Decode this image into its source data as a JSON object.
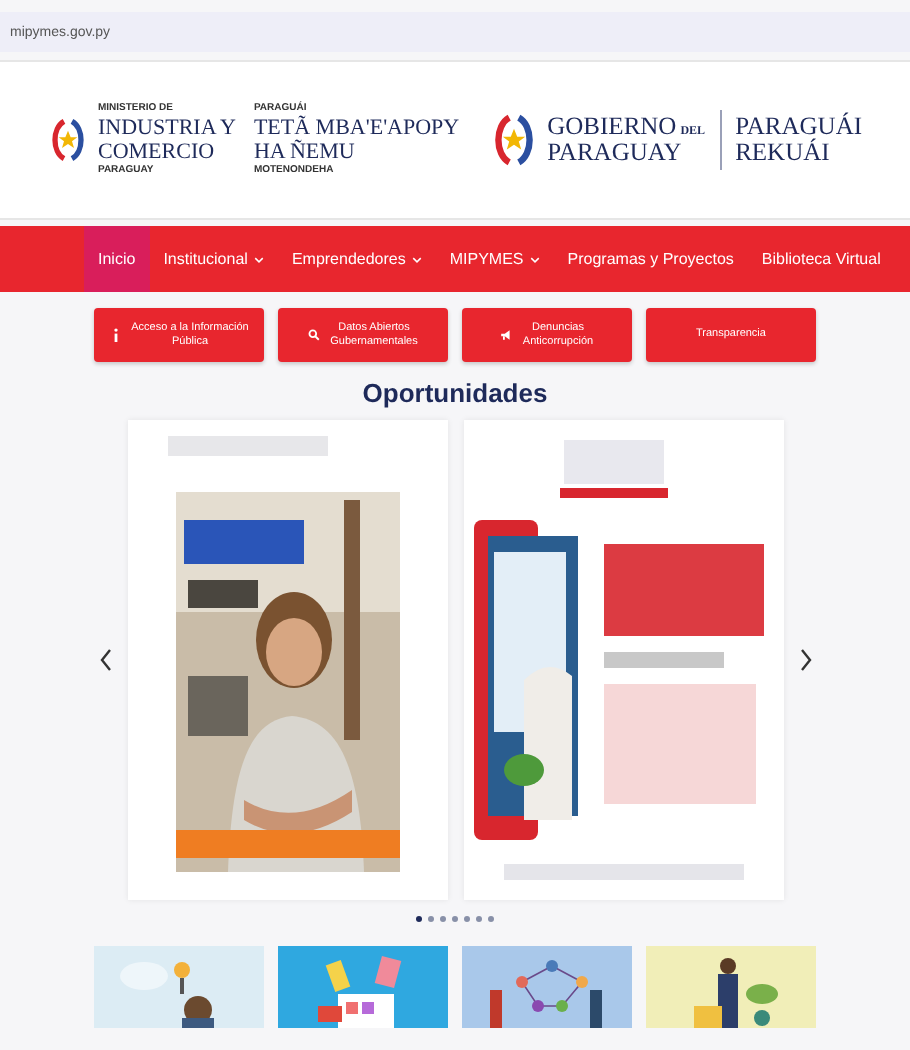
{
  "url": "mipymes.gov.py",
  "header": {
    "ministry": {
      "top": "MINISTERIO DE",
      "name_lines": [
        "INDUSTRIA Y",
        "COMERCIO"
      ],
      "bottom": "PARAGUAY"
    },
    "ministry_guarani": {
      "top": "PARAGUÁI",
      "name_lines": [
        "TETÃ MBA'E'APOPY",
        "HA ÑEMU"
      ],
      "bottom": "MOTENONDEHA"
    },
    "government": {
      "name": "GOBIERNO",
      "small": "DEL",
      "country": "PARAGUAY",
      "slogan_lines": [
        "PARAGUÁI",
        "REKUÁI"
      ]
    }
  },
  "nav": [
    {
      "label": "Inicio",
      "selected": true,
      "dropdown": false
    },
    {
      "label": "Institucional",
      "selected": false,
      "dropdown": true
    },
    {
      "label": "Emprendedores",
      "selected": false,
      "dropdown": true
    },
    {
      "label": "MIPYMES",
      "selected": false,
      "dropdown": true
    },
    {
      "label": "Programas y Proyectos",
      "selected": false,
      "dropdown": false
    },
    {
      "label": "Biblioteca Virtual",
      "selected": false,
      "dropdown": false
    }
  ],
  "quick_links": [
    {
      "kind": "info",
      "label_lines": [
        "Acceso a la Información",
        "Pública"
      ]
    },
    {
      "kind": "search",
      "label_lines": [
        "Datos Abiertos",
        "Gubernamentales"
      ]
    },
    {
      "kind": "megaphone",
      "label_lines": [
        "Denuncias",
        "Anticorrupción"
      ]
    },
    {
      "kind": "plain",
      "label_lines": [
        "Transparencia"
      ]
    }
  ],
  "section_title": "Oportunidades",
  "carousel": {
    "dots": [
      {
        "selected": true
      },
      {
        "selected": false
      },
      {
        "selected": false
      },
      {
        "selected": false
      },
      {
        "selected": false
      },
      {
        "selected": false
      },
      {
        "selected": false
      }
    ]
  }
}
